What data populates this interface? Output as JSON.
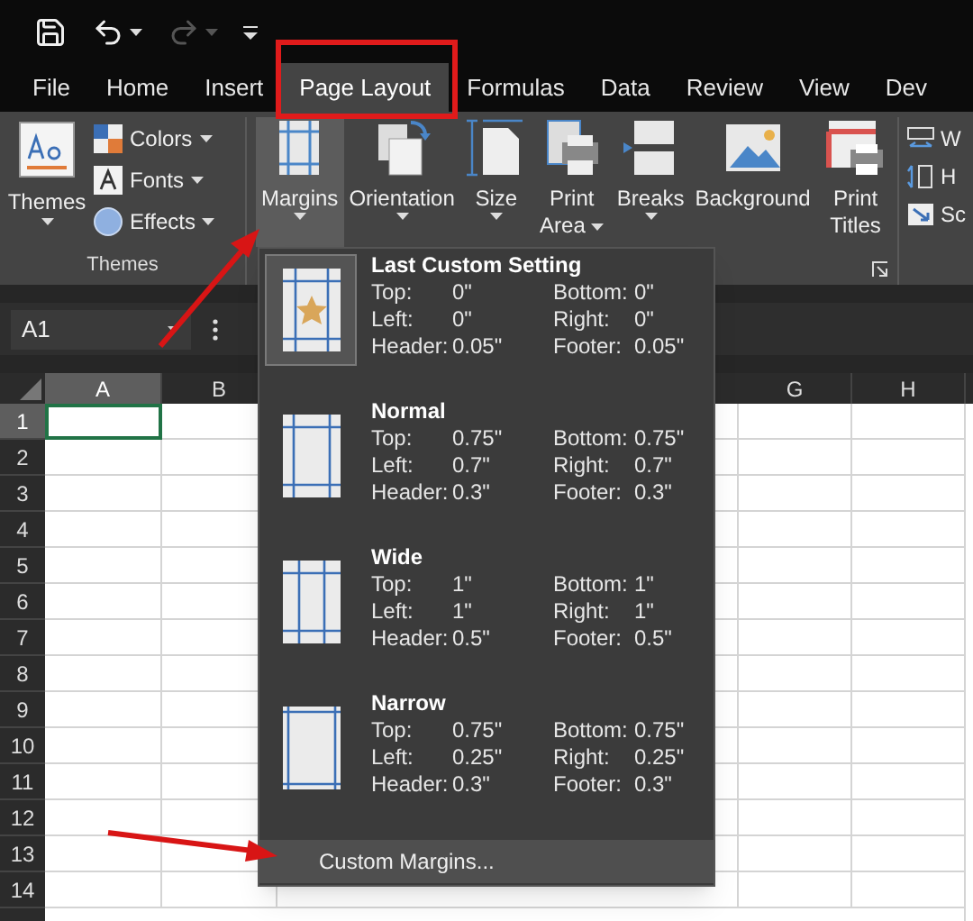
{
  "tabs": [
    {
      "label": "File",
      "selected": false
    },
    {
      "label": "Home",
      "selected": false
    },
    {
      "label": "Insert",
      "selected": false
    },
    {
      "label": "Page Layout",
      "selected": true
    },
    {
      "label": "Formulas",
      "selected": false
    },
    {
      "label": "Data",
      "selected": false
    },
    {
      "label": "Review",
      "selected": false
    },
    {
      "label": "View",
      "selected": false
    },
    {
      "label": "Dev",
      "selected": false
    }
  ],
  "ribbon": {
    "themes_group": {
      "label": "Themes",
      "button": "Themes",
      "options": [
        {
          "label": "Colors",
          "kind": "colors"
        },
        {
          "label": "Fonts",
          "kind": "fonts"
        },
        {
          "label": "Effects",
          "kind": "effects"
        }
      ]
    },
    "page_setup": [
      {
        "label": "Margins",
        "kind": "margins",
        "pressed": true,
        "dropdown": true
      },
      {
        "label": "Orientation",
        "kind": "orientation",
        "pressed": false,
        "dropdown": true
      },
      {
        "label": "Size",
        "kind": "size",
        "pressed": false,
        "dropdown": true
      },
      {
        "label": "Print Area",
        "kind": "print_area",
        "pressed": false,
        "dropdown": true
      },
      {
        "label": "Breaks",
        "kind": "breaks",
        "pressed": false,
        "dropdown": true
      },
      {
        "label": "Background",
        "kind": "background",
        "pressed": false,
        "dropdown": false
      },
      {
        "label": "Print Titles",
        "kind": "print_titles",
        "pressed": false,
        "dropdown": false
      }
    ],
    "partial_group": [
      {
        "label": "W",
        "kind": "width"
      },
      {
        "label": "H",
        "kind": "height"
      },
      {
        "label": "Sc",
        "kind": "scale"
      }
    ]
  },
  "name_box": "A1",
  "columns": [
    {
      "label": "A",
      "selected": true
    },
    {
      "label": "B",
      "selected": false
    },
    {
      "label": "G",
      "selected": false
    },
    {
      "label": "H",
      "selected": false
    }
  ],
  "rows": [
    {
      "label": "1",
      "selected": true
    },
    {
      "label": "2",
      "selected": false
    },
    {
      "label": "3",
      "selected": false
    },
    {
      "label": "4",
      "selected": false
    },
    {
      "label": "5",
      "selected": false
    },
    {
      "label": "6",
      "selected": false
    },
    {
      "label": "7",
      "selected": false
    },
    {
      "label": "8",
      "selected": false
    },
    {
      "label": "9",
      "selected": false
    },
    {
      "label": "10",
      "selected": false
    },
    {
      "label": "11",
      "selected": false
    },
    {
      "label": "12",
      "selected": false
    },
    {
      "label": "13",
      "selected": false
    },
    {
      "label": "14",
      "selected": false
    }
  ],
  "margins_menu": {
    "items": [
      {
        "title": "Last Custom Setting",
        "kind": "custom",
        "selected": true,
        "fields": [
          {
            "label": "Top:",
            "value": "0\""
          },
          {
            "label": "Bottom:",
            "value": "0\""
          },
          {
            "label": "Left:",
            "value": "0\""
          },
          {
            "label": "Right:",
            "value": "0\""
          },
          {
            "label": "Header:",
            "value": "0.05\""
          },
          {
            "label": "Footer:",
            "value": "0.05\""
          }
        ]
      },
      {
        "title": "Normal",
        "kind": "normal",
        "selected": false,
        "fields": [
          {
            "label": "Top:",
            "value": "0.75\""
          },
          {
            "label": "Bottom:",
            "value": "0.75\""
          },
          {
            "label": "Left:",
            "value": "0.7\""
          },
          {
            "label": "Right:",
            "value": "0.7\""
          },
          {
            "label": "Header:",
            "value": "0.3\""
          },
          {
            "label": "Footer:",
            "value": "0.3\""
          }
        ]
      },
      {
        "title": "Wide",
        "kind": "wide",
        "selected": false,
        "fields": [
          {
            "label": "Top:",
            "value": "1\""
          },
          {
            "label": "Bottom:",
            "value": "1\""
          },
          {
            "label": "Left:",
            "value": "1\""
          },
          {
            "label": "Right:",
            "value": "1\""
          },
          {
            "label": "Header:",
            "value": "0.5\""
          },
          {
            "label": "Footer:",
            "value": "0.5\""
          }
        ]
      },
      {
        "title": "Narrow",
        "kind": "narrow",
        "selected": false,
        "fields": [
          {
            "label": "Top:",
            "value": "0.75\""
          },
          {
            "label": "Bottom:",
            "value": "0.75\""
          },
          {
            "label": "Left:",
            "value": "0.25\""
          },
          {
            "label": "Right:",
            "value": "0.25\""
          },
          {
            "label": "Header:",
            "value": "0.3\""
          },
          {
            "label": "Footer:",
            "value": "0.3\""
          }
        ]
      }
    ],
    "custom": {
      "label": "Custom Margins...",
      "highlighted": true
    }
  }
}
